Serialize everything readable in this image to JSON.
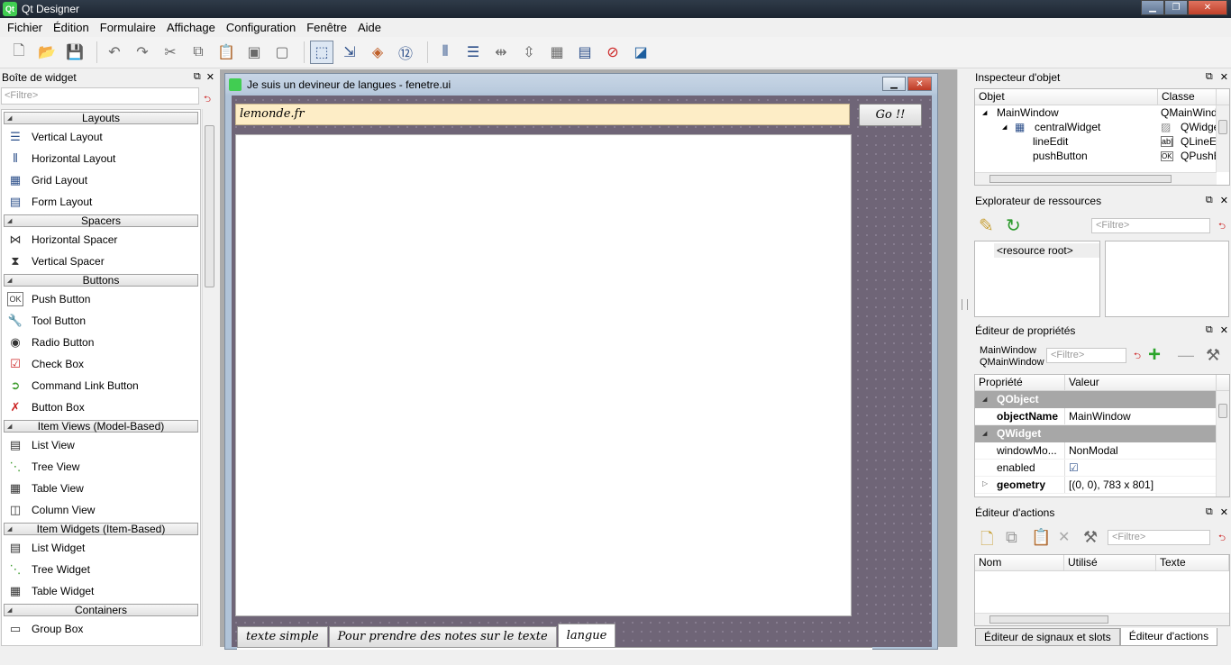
{
  "window": {
    "title": "Qt Designer",
    "app_icon": "Qt",
    "minimize": "▁",
    "maximize": "❐",
    "close": "✕"
  },
  "menu": [
    "Fichier",
    "Édition",
    "Formulaire",
    "Affichage",
    "Configuration",
    "Fenêtre",
    "Aide"
  ],
  "widget_box": {
    "title": "Boîte de widget",
    "filter_placeholder": "<Filtre>",
    "categories": {
      "layouts": "Layouts",
      "spacers": "Spacers",
      "buttons": "Buttons",
      "item_views": "Item Views (Model-Based)",
      "item_widgets": "Item Widgets (Item-Based)",
      "containers": "Containers"
    },
    "items": {
      "vertical_layout": "Vertical Layout",
      "horizontal_layout": "Horizontal Layout",
      "grid_layout": "Grid Layout",
      "form_layout": "Form Layout",
      "horizontal_spacer": "Horizontal Spacer",
      "vertical_spacer": "Vertical Spacer",
      "push_button": "Push Button",
      "tool_button": "Tool Button",
      "radio_button": "Radio Button",
      "check_box": "Check Box",
      "command_link_button": "Command Link Button",
      "button_box": "Button Box",
      "list_view": "List View",
      "tree_view": "Tree View",
      "table_view": "Table View",
      "column_view": "Column View",
      "list_widget": "List Widget",
      "tree_widget": "Tree Widget",
      "table_widget": "Table Widget",
      "group_box": "Group Box"
    }
  },
  "form": {
    "title": "Je suis un devineur de langues - fenetre.ui",
    "line_edit_value": "lemonde.fr",
    "go_button": "Go !!",
    "tabs": [
      "texte simple",
      "Pour prendre des notes sur le texte",
      "langue"
    ]
  },
  "object_inspector": {
    "title": "Inspecteur d'objet",
    "col_object": "Objet",
    "col_class": "Classe",
    "rows": [
      {
        "name": "MainWindow",
        "class": "QMainWindow"
      },
      {
        "name": "centralWidget",
        "class": "QWidget"
      },
      {
        "name": "lineEdit",
        "class": "QLineEdit"
      },
      {
        "name": "pushButton",
        "class": "QPushButton"
      }
    ]
  },
  "resource_browser": {
    "title": "Explorateur de ressources",
    "filter_placeholder": "<Filtre>",
    "root": "<resource root>"
  },
  "property_editor": {
    "title": "Éditeur de propriétés",
    "object_name": "MainWindow",
    "object_class": "QMainWindow",
    "filter_placeholder": "<Filtre>",
    "col_property": "Propriété",
    "col_value": "Valeur",
    "sections": [
      "QObject",
      "QWidget"
    ],
    "props": {
      "objectName": {
        "name": "objectName",
        "value": "MainWindow"
      },
      "windowModality": {
        "name": "windowMo...",
        "value": "NonModal"
      },
      "enabled": {
        "name": "enabled",
        "value": "☑"
      },
      "geometry": {
        "name": "geometry",
        "value": "[(0, 0), 783 x 801]"
      }
    }
  },
  "action_editor": {
    "title": "Éditeur d'actions",
    "filter_placeholder": "<Filtre>",
    "col_name": "Nom",
    "col_used": "Utilisé",
    "col_text": "Texte"
  },
  "bottom_tabs": [
    "Éditeur de signaux et slots",
    "Éditeur d'actions"
  ]
}
